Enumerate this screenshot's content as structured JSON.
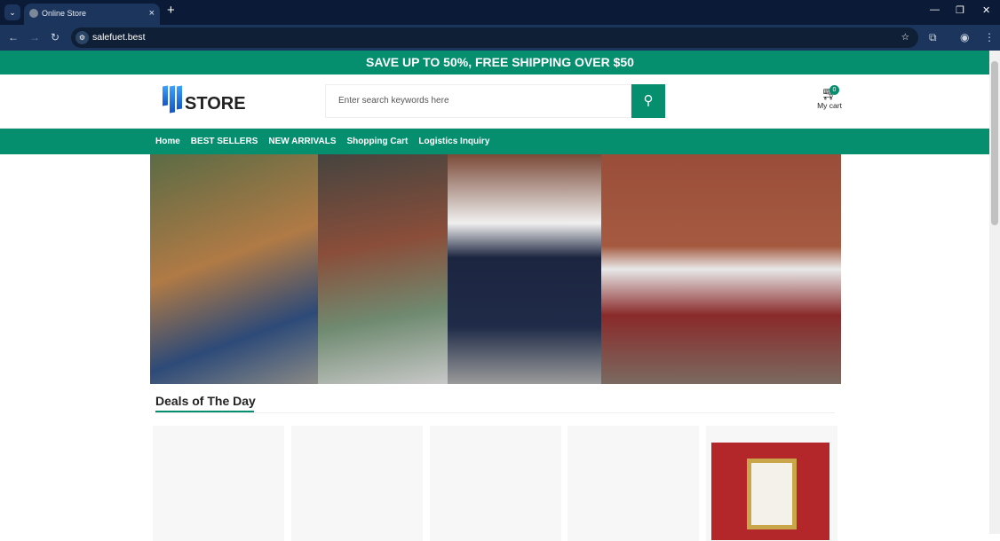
{
  "browser": {
    "tab_title": "Online Store",
    "url": "salefuet.best",
    "new_tab": "+",
    "close": "×"
  },
  "promo": "SAVE UP TO 50%, FREE SHIPPING OVER $50",
  "logo": "STORE",
  "search": {
    "placeholder": "Enter search keywords here"
  },
  "cart": {
    "count": "0",
    "label": "My cart"
  },
  "menu": [
    "Home",
    "BEST SELLERS",
    "NEW ARRIVALS",
    "Shopping Cart",
    "Logistics Inquiry"
  ],
  "deals_title": "Deals of The Day",
  "colors": {
    "accent": "#058f6f"
  }
}
